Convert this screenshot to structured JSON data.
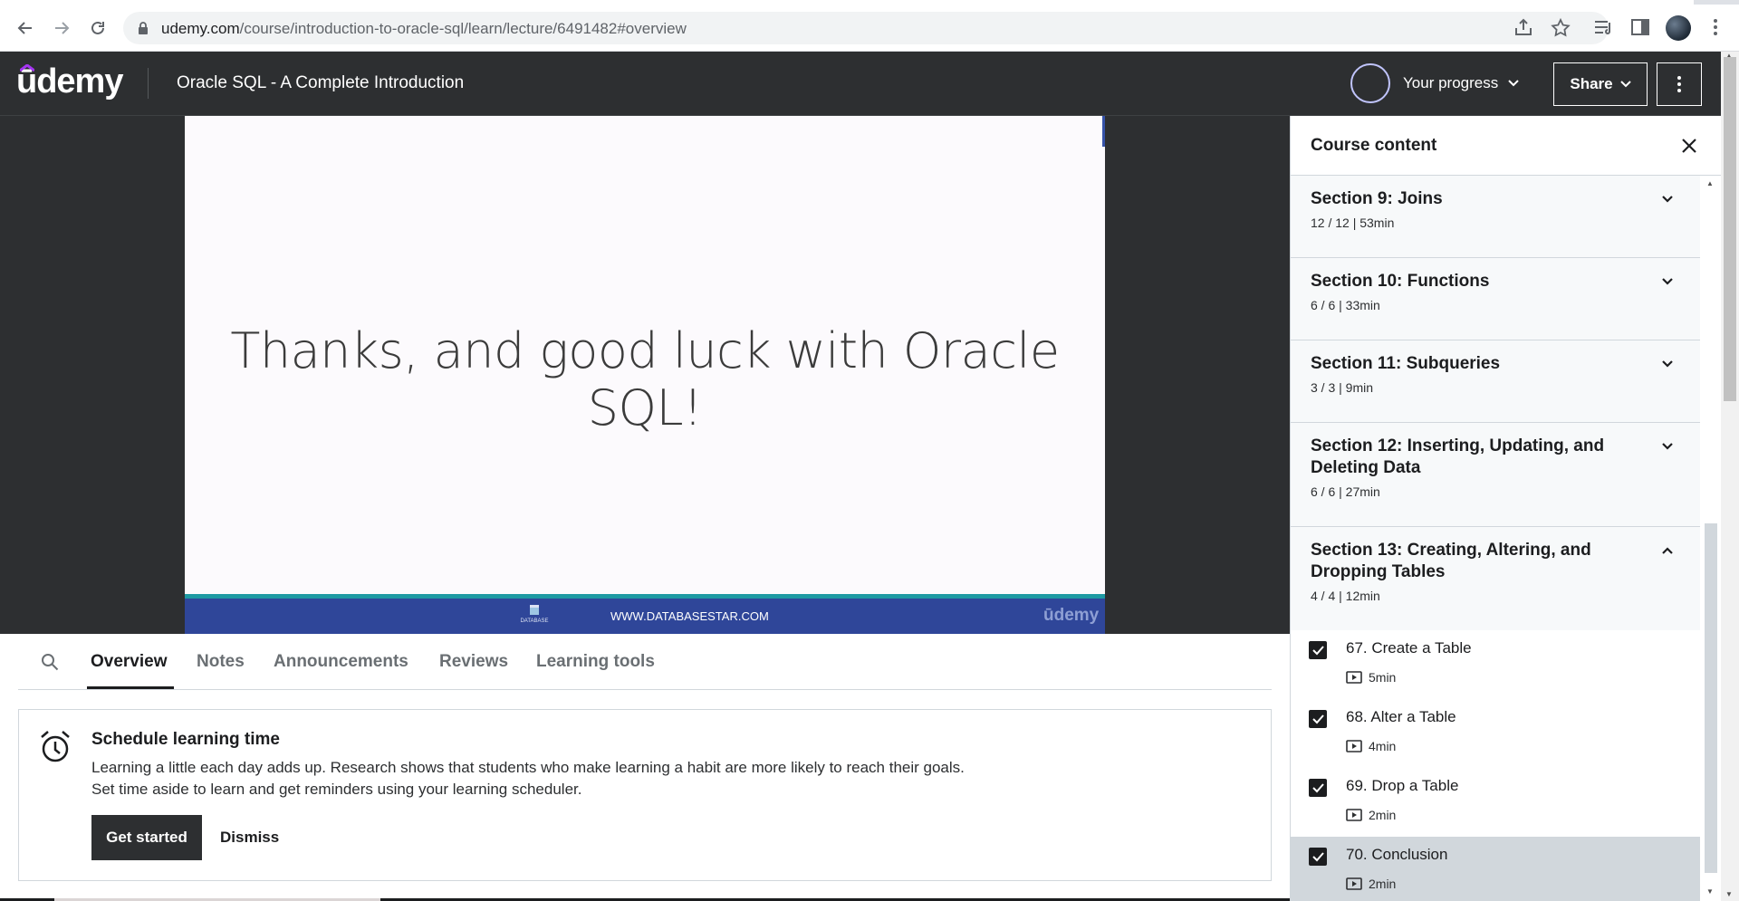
{
  "browser": {
    "url_host": "udemy.com",
    "url_path": "/course/introduction-to-oracle-sql/learn/lecture/6491482#overview"
  },
  "header": {
    "logo": "ūdemy",
    "course_title": "Oracle SQL - A Complete Introduction",
    "progress_label": "Your progress",
    "share_label": "Share"
  },
  "video": {
    "slide_text": "Thanks, and good luck with Oracle SQL!",
    "footer_site": "WWW.DATABASESTAR.COM",
    "footer_logo_text": "DATABASE",
    "footer_brand": "ūdemy"
  },
  "tabs": {
    "items": [
      {
        "label": "Overview",
        "active": true
      },
      {
        "label": "Notes",
        "active": false
      },
      {
        "label": "Announcements",
        "active": false
      },
      {
        "label": "Reviews",
        "active": false
      },
      {
        "label": "Learning tools",
        "active": false
      }
    ]
  },
  "schedule": {
    "title": "Schedule learning time",
    "line1": "Learning a little each day adds up. Research shows that students who make learning a habit are more likely to reach their goals.",
    "line2": "Set time aside to learn and get reminders using your learning scheduler.",
    "start_label": "Get started",
    "dismiss_label": "Dismiss"
  },
  "sidebar": {
    "title": "Course content",
    "sections": [
      {
        "title": "Section 9: Joins",
        "meta": "12 / 12 | 53min",
        "expanded": false
      },
      {
        "title": "Section 10: Functions",
        "meta": "6 / 6 | 33min",
        "expanded": false
      },
      {
        "title": "Section 11: Subqueries",
        "meta": "3 / 3 | 9min",
        "expanded": false
      },
      {
        "title": "Section 12: Inserting, Updating, and Deleting Data",
        "meta": "6 / 6 | 27min",
        "expanded": false
      },
      {
        "title": "Section 13: Creating, Altering, and Dropping Tables",
        "meta": "4 / 4 | 12min",
        "expanded": true
      }
    ],
    "lectures": [
      {
        "title": "67. Create a Table",
        "duration": "5min",
        "checked": true,
        "current": false
      },
      {
        "title": "68. Alter a Table",
        "duration": "4min",
        "checked": true,
        "current": false
      },
      {
        "title": "69. Drop a Table",
        "duration": "2min",
        "checked": true,
        "current": false
      },
      {
        "title": "70. Conclusion",
        "duration": "2min",
        "checked": true,
        "current": true
      }
    ]
  },
  "icons": {
    "back": "arrow-left-icon",
    "forward": "arrow-right-icon",
    "reload": "reload-icon",
    "lock": "lock-icon",
    "share_page": "share-page-icon",
    "bookmark": "star-icon",
    "tab_search": "reading-list-icon",
    "side_panel": "side-panel-icon",
    "menu": "kebab-menu-icon"
  },
  "colors": {
    "udemy_dark": "#2d2f31",
    "accent_purple": "#a435f0",
    "slide_footer": "#2f4699",
    "slide_teal": "#1e9aa3",
    "current_lecture_bg": "#d1d7dc"
  }
}
